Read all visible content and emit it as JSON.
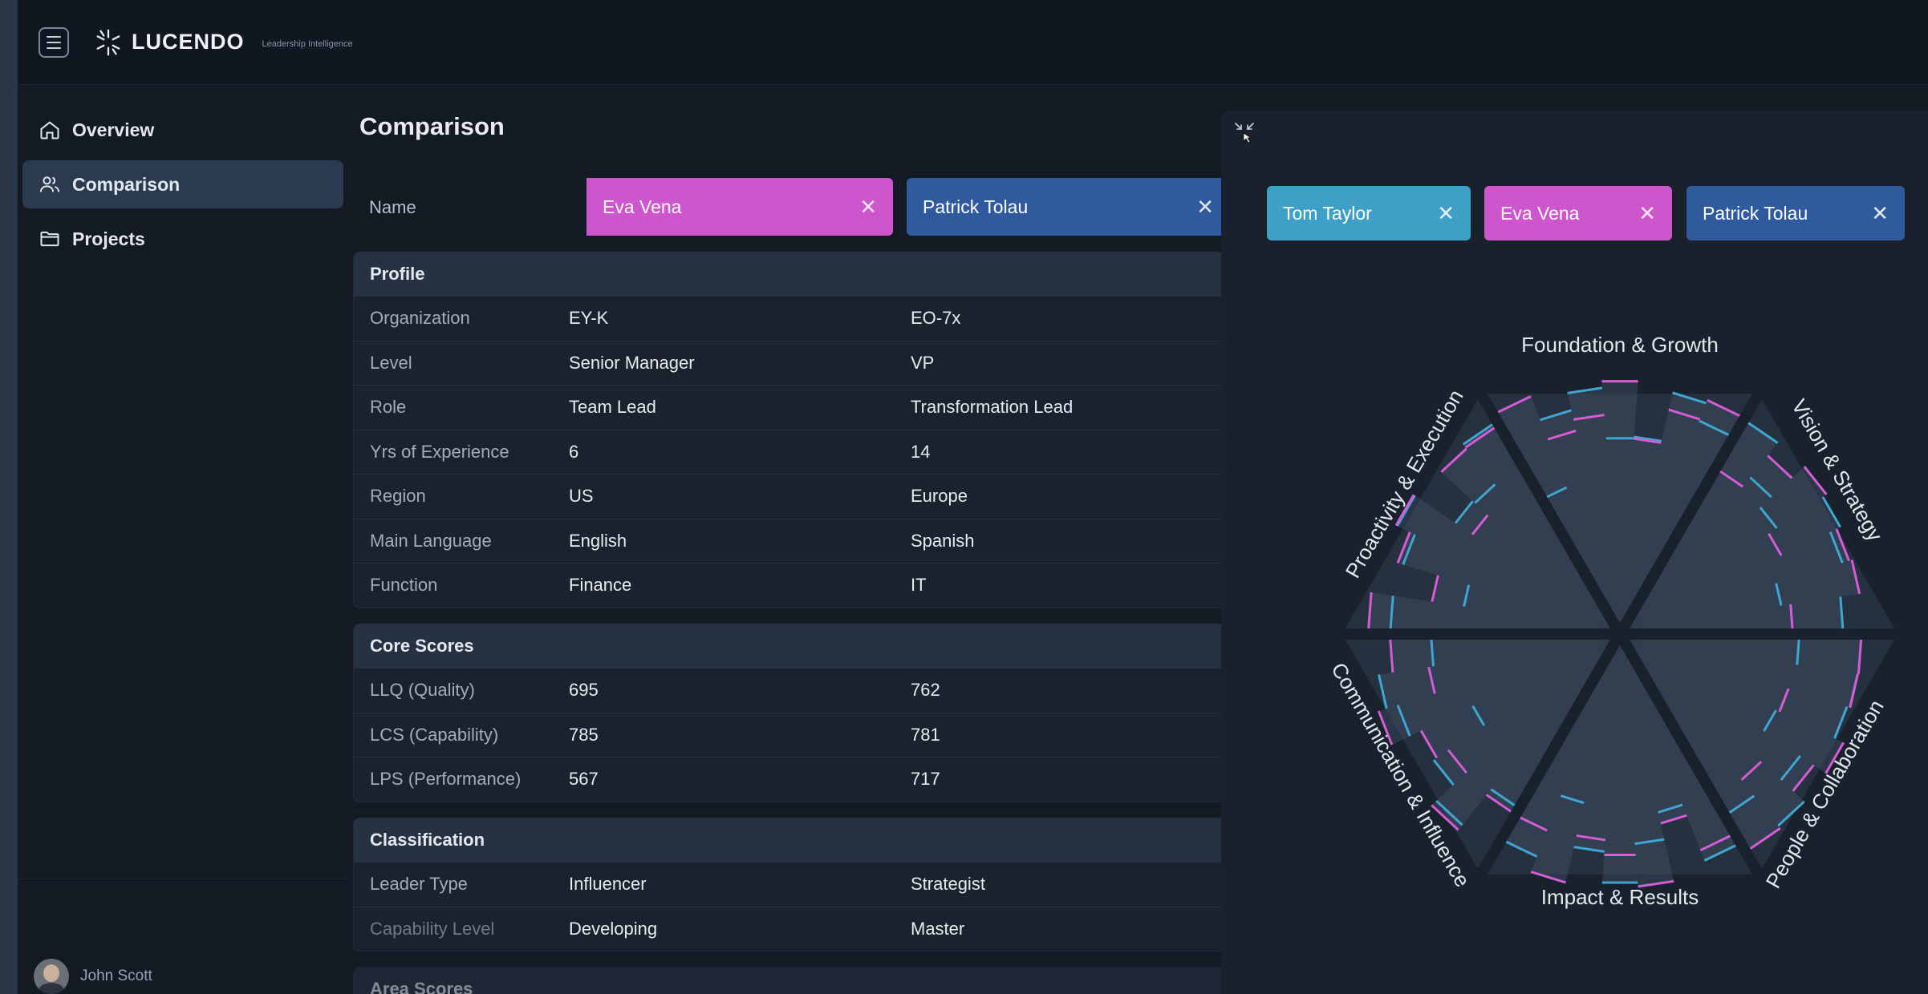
{
  "app": {
    "name": "LUCENDO",
    "tagline": "Leadership Intelligence"
  },
  "sidebar": {
    "items": [
      {
        "label": "Overview",
        "icon": "home-icon",
        "active": false
      },
      {
        "label": "Comparison",
        "icon": "users-icon",
        "active": true
      },
      {
        "label": "Projects",
        "icon": "folder-icon",
        "active": false
      }
    ],
    "user": {
      "name": "John Scott"
    }
  },
  "page": {
    "title": "Comparison",
    "name_label": "Name"
  },
  "compare": {
    "people": [
      {
        "name": "Eva Vena",
        "visible_name": "Eva Vena",
        "color": "#cd56cc"
      },
      {
        "name": "Patrick Tolau",
        "visible_name": "Patrick Tolau",
        "color": "#2f5a9e"
      }
    ]
  },
  "profile": {
    "title": "Profile",
    "rows": [
      {
        "label": "Organization",
        "v1": "EY-K",
        "v2": "EO-7x"
      },
      {
        "label": "Level",
        "v1": "Senior Manager",
        "v2": "VP"
      },
      {
        "label": "Role",
        "v1": "Team Lead",
        "v2": "Transformation Lead"
      },
      {
        "label": "Yrs of Experience",
        "v1": "6",
        "v2": "14"
      },
      {
        "label": "Region",
        "v1": "US",
        "v2": "Europe"
      },
      {
        "label": "Main Language",
        "v1": "English",
        "v2": "Spanish"
      },
      {
        "label": "Function",
        "v1": "Finance",
        "v2": "IT"
      }
    ]
  },
  "core": {
    "title": "Core Scores",
    "rows": [
      {
        "label": "LLQ (Quality)",
        "v1": "695",
        "v2": "762"
      },
      {
        "label": "LCS (Capability)",
        "v1": "785",
        "v2": "781"
      },
      {
        "label": "LPS (Performance)",
        "v1": "567",
        "v2": "717"
      }
    ]
  },
  "classification": {
    "title": "Classification",
    "rows": [
      {
        "label": "Leader Type",
        "v1": "Influencer",
        "v2": "Strategist"
      },
      {
        "label": "Capability Level",
        "v1": "Developing",
        "v2": "Master"
      }
    ]
  },
  "area_scores": {
    "title": "Area Scores"
  },
  "radar": {
    "chips": [
      {
        "name": "Tom Taylor",
        "color": "#3ea0c6"
      },
      {
        "name": "Eva Vena",
        "color": "#cd56cc"
      },
      {
        "name": "Patrick Tolau",
        "color": "#2f5a9e"
      }
    ],
    "areas": [
      "Foundation & Growth",
      "Vision & Strategy",
      "People & Collaboration",
      "Impact & Results",
      "Communication & Influence",
      "Proactivity & Execution"
    ],
    "series_colors": {
      "tom": "#3fa6d2",
      "eva": "#d65bd6"
    }
  }
}
